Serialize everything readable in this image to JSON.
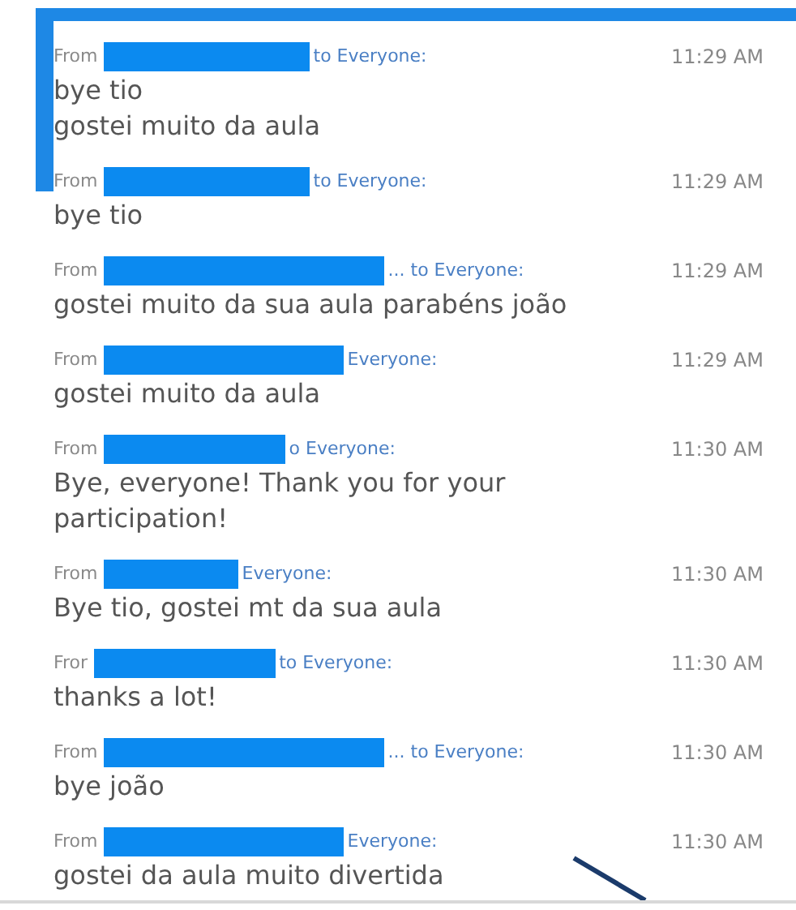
{
  "messages": [
    {
      "from_label": "From",
      "kind": "standard",
      "recipient": "to Everyone:",
      "time": "11:29 AM",
      "lines": [
        "bye tio",
        "gostei muito da aula"
      ]
    },
    {
      "from_label": "From",
      "kind": "standard",
      "recipient": "to Everyone:",
      "time": "11:29 AM",
      "lines": [
        "bye tio"
      ]
    },
    {
      "from_label": "From",
      "kind": "long",
      "recipient": "... to Everyone:",
      "time": "11:29 AM",
      "lines": [
        "gostei muito da sua aula parabéns joão"
      ]
    },
    {
      "from_label": "From",
      "kind": "wide",
      "recipient": "Everyone:",
      "time": "11:29 AM",
      "lines": [
        "gostei muito da aula"
      ]
    },
    {
      "from_label": "From",
      "kind": "medium",
      "recipient": "o Everyone:",
      "time": "11:30 AM",
      "lines": [
        "Bye, everyone! Thank you for your participation!"
      ]
    },
    {
      "from_label": "From",
      "kind": "short",
      "recipient": "Everyone:",
      "time": "11:30 AM",
      "lines": [
        "Bye tio, gostei mt da sua aula"
      ]
    },
    {
      "from_label": "Fror",
      "kind": "medium",
      "recipient": "to Everyone:",
      "time": "11:30 AM",
      "lines": [
        "thanks a lot!"
      ]
    },
    {
      "from_label": "From",
      "kind": "long",
      "recipient": "... to Everyone:",
      "time": "11:30 AM",
      "lines": [
        "bye joão"
      ]
    },
    {
      "from_label": "From",
      "kind": "wide",
      "recipient": "Everyone:",
      "time": "11:30 AM",
      "lines": [
        "gostei da aula muito divertida"
      ]
    }
  ]
}
